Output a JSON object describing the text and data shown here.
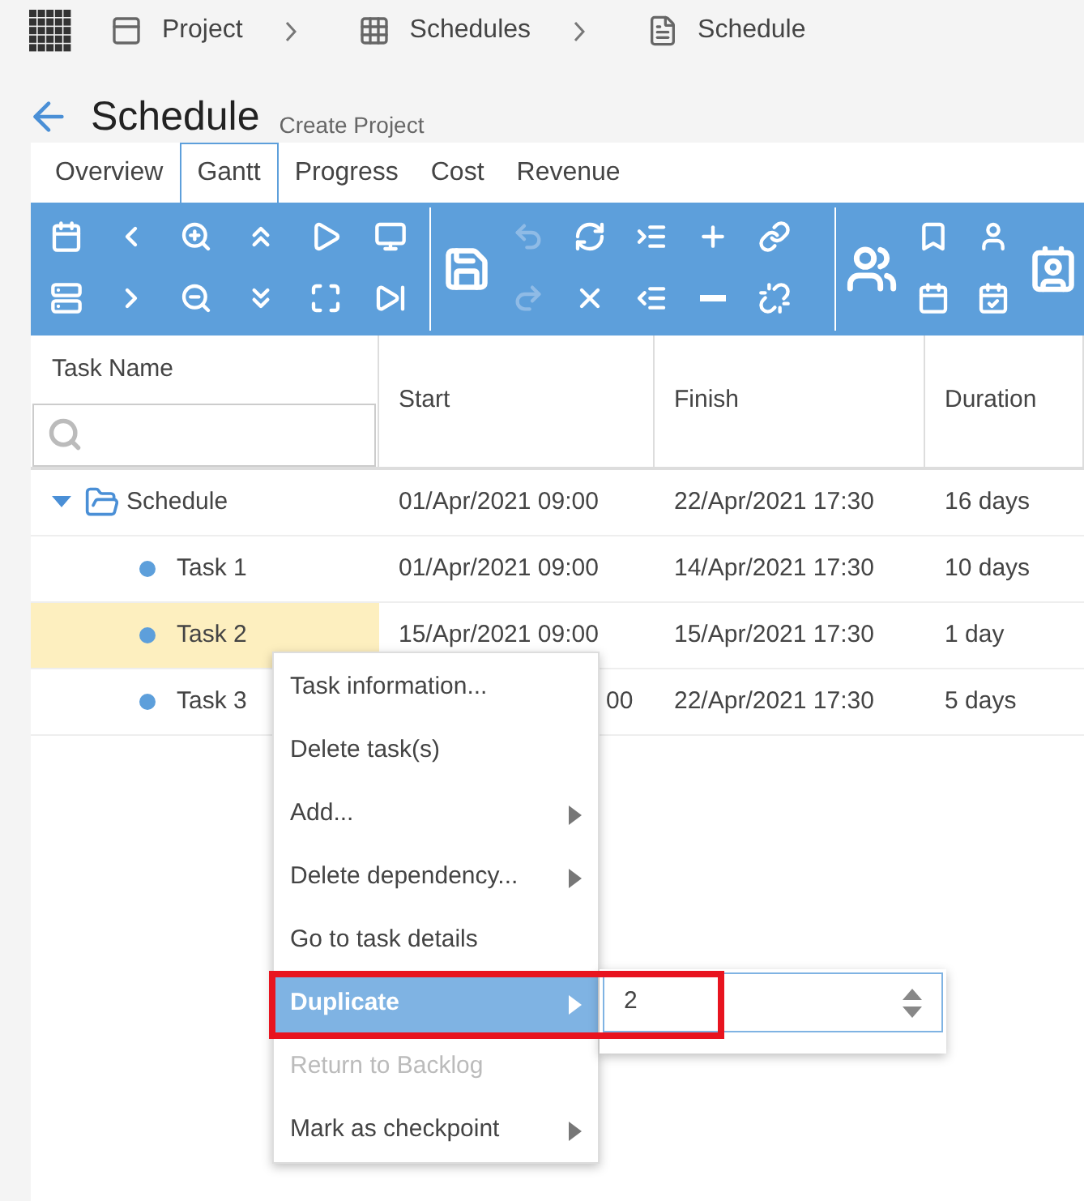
{
  "breadcrumbs": [
    {
      "label": "Project",
      "kind": "project"
    },
    {
      "label": "Schedules",
      "kind": "grid"
    },
    {
      "label": "Schedule",
      "kind": "page"
    }
  ],
  "header": {
    "title": "Schedule",
    "subtitle": "Create Project"
  },
  "tabs": [
    {
      "label": "Overview",
      "selected": false
    },
    {
      "label": "Gantt",
      "selected": true
    },
    {
      "label": "Progress",
      "selected": false
    },
    {
      "label": "Cost",
      "selected": false
    },
    {
      "label": "Revenue",
      "selected": false
    }
  ],
  "toolbar": {
    "groups": [
      {
        "buttons": [
          {
            "disabled": false
          },
          {
            "disabled": false
          },
          {
            "disabled": false
          },
          {
            "disabled": false
          },
          {
            "disabled": false
          },
          {
            "disabled": false
          },
          {
            "disabled": false
          },
          {
            "disabled": false
          },
          {
            "disabled": false
          },
          {
            "disabled": false
          },
          {
            "disabled": false
          },
          {
            "disabled": false
          }
        ]
      },
      {
        "buttons": [
          {
            "disabled": false
          },
          {
            "disabled": true
          },
          {
            "disabled": false
          },
          {
            "disabled": false
          },
          {
            "disabled": false
          },
          {
            "disabled": false
          },
          {
            "disabled": true
          },
          {
            "disabled": false
          },
          {
            "disabled": false
          },
          {
            "disabled": false
          },
          {
            "disabled": false
          }
        ]
      },
      {
        "buttons": [
          {
            "disabled": false
          },
          {
            "disabled": false
          },
          {
            "disabled": false
          },
          {
            "disabled": false
          },
          {
            "disabled": false
          },
          {
            "disabled": false
          }
        ]
      }
    ]
  },
  "table": {
    "columns": [
      "Task Name",
      "Start",
      "Finish",
      "Duration"
    ],
    "rows": [
      {
        "name": "Schedule",
        "start": "01/Apr/2021 09:00",
        "finish": "22/Apr/2021 17:30",
        "duration": "16 days",
        "expanded": true,
        "selected": false,
        "children": [
          {
            "name": "Task 1",
            "start": "01/Apr/2021 09:00",
            "finish": "14/Apr/2021 17:30",
            "duration": "10 days",
            "selected": false
          },
          {
            "name": "Task 2",
            "start": "15/Apr/2021 09:00",
            "finish": "15/Apr/2021 17:30",
            "duration": "1 day",
            "selected": true
          },
          {
            "name": "Task 3",
            "finish": "22/Apr/2021 17:30",
            "duration": "5 days",
            "selected": false,
            "start_partial": "00"
          }
        ]
      }
    ]
  },
  "context_menu": {
    "items": [
      {
        "label": "Task information...",
        "submenu": false,
        "disabled": false,
        "selected": false
      },
      {
        "label": "Delete task(s)",
        "submenu": false,
        "disabled": false,
        "selected": false
      },
      {
        "label": "Add...",
        "submenu": true,
        "disabled": false,
        "selected": false
      },
      {
        "label": "Delete dependency...",
        "submenu": true,
        "disabled": false,
        "selected": false
      },
      {
        "label": "Go to task details",
        "submenu": false,
        "disabled": false,
        "selected": false
      },
      {
        "label": "Duplicate",
        "submenu": true,
        "disabled": false,
        "selected": true
      },
      {
        "label": "Return to Backlog",
        "submenu": false,
        "disabled": true,
        "selected": false
      },
      {
        "label": "Mark as checkpoint",
        "submenu": true,
        "disabled": false,
        "selected": false
      }
    ],
    "duplicate_count": {
      "value": "2"
    }
  }
}
